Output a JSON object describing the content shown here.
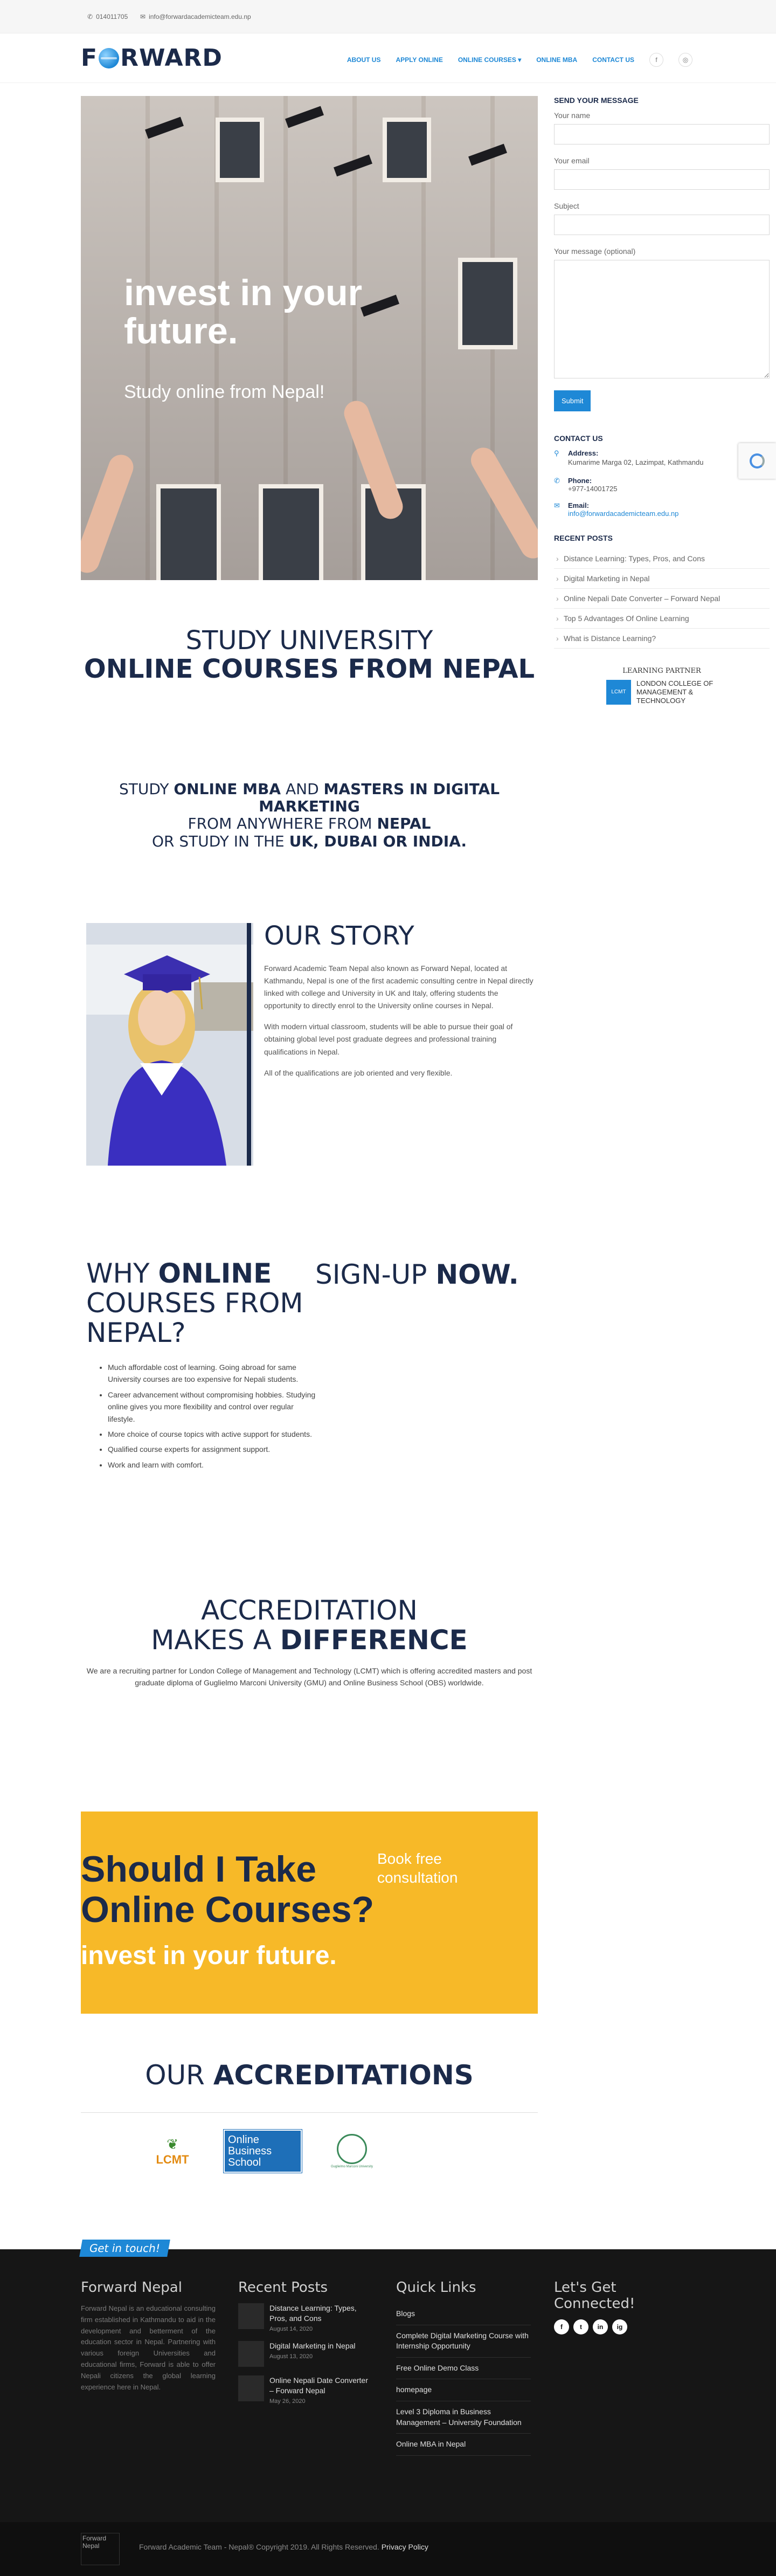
{
  "topbar": {
    "phone": "014011705",
    "email": "info@forwardacademicteam.edu.np"
  },
  "header": {
    "logo_left": "F",
    "logo_right": "RWARD",
    "nav": [
      "ABOUT US",
      "APPLY ONLINE",
      "ONLINE COURSES ▾",
      "ONLINE MBA",
      "CONTACT US"
    ],
    "social": [
      "facebook-icon",
      "instagram-icon"
    ]
  },
  "hero": {
    "title": "invest in your future.",
    "subtitle": "Study online from Nepal!"
  },
  "sidebar": {
    "form_title": "SEND YOUR MESSAGE",
    "name_label": "Your name",
    "email_label": "Your email",
    "subject_label": "Subject",
    "message_label": "Your message (optional)",
    "submit": "Submit",
    "contact_title": "CONTACT US",
    "address_label": "Address:",
    "address": "Kumarime Marga 02, Lazimpat, Kathmandu",
    "phone_label": "Phone:",
    "phone": "+977-14001725",
    "email_label2": "Email:",
    "email": "info@forwardacademicteam.edu.np",
    "posts_title": "RECENT POSTS",
    "posts": [
      "Distance Learning: Types, Pros, and Cons",
      "Digital Marketing in Nepal",
      "Online Nepali Date Converter – Forward Nepal",
      "Top 5 Advantages Of Online Learning",
      "What is Distance Learning?"
    ],
    "partner_label": "LEARNING PARTNER",
    "partner_name": "LONDON COLLEGE OF MANAGEMENT & TECHNOLOGY",
    "partner_mark": "LCMT"
  },
  "study": {
    "line1": "STUDY UNIVERSITY",
    "line2": "ONLINE COURSES FROM NEPAL"
  },
  "online": {
    "a1": "STUDY ",
    "a2": "ONLINE MBA",
    "a3": " AND ",
    "a4": "MASTERS IN DIGITAL MARKETING",
    "b1": "FROM ANYWHERE FROM ",
    "b2": "NEPAL",
    "c1": "OR STUDY IN THE ",
    "c2": "UK, DUBAI OR INDIA."
  },
  "story": {
    "title": "OUR STORY",
    "p1": "Forward Academic Team Nepal also known as Forward Nepal, located at Kathmandu, Nepal is one of the first academic consulting centre in Nepal directly linked with college and University in UK and Italy, offering students the opportunity to directly enrol to the University online courses in Nepal.",
    "p2": "With modern virtual classroom, students will be able to pursue their goal of obtaining global level post graduate degrees and professional training qualifications in Nepal.",
    "p3": "All of the qualifications are job oriented and very flexible."
  },
  "why": {
    "w1": "WHY ",
    "w2": "ONLINE",
    "w3": "COURSES FROM NEPAL?",
    "s1": "SIGN-UP ",
    "s2": "NOW.",
    "items": [
      "Much affordable cost of learning. Going abroad for same University courses are too expensive for Nepali students.",
      "Career advancement without compromising hobbies. Studying online gives you more flexibility and control over regular lifestyle.",
      "More choice of course topics with active support for students.",
      "Qualified course experts for assignment support.",
      "Work and learn with comfort."
    ]
  },
  "accreditation": {
    "l1": "ACCREDITATION",
    "l2a": "MAKES A ",
    "l2b": "DIFFERENCE",
    "desc": "We are a recruiting partner for London College of Management and Technology (LCMT) which is offering accredited masters and post graduate diploma of Guglielmo Marconi University (GMU) and Online Business School (OBS) worldwide."
  },
  "cta": {
    "question": "Should I Take Online Courses?",
    "book": "Book free consultation",
    "foot": "invest in your future."
  },
  "our_acc": {
    "a": "OUR ",
    "b": "ACCREDITATIONS",
    "logos": [
      "LCMT",
      "Online Business School",
      "Guglielmo Marconi University"
    ]
  },
  "footer": {
    "tab": "Get in touch!",
    "col1_title": "Forward Nepal",
    "col1_text": "Forward Nepal is an educational consulting firm established in Kathmandu to aid in the development and betterment of the education sector in Nepal. Partnering with various foreign Universities and educational firms, Forward is able to offer Nepali citizens the global learning experience here in Nepal.",
    "col2_title": "Recent Posts",
    "posts": [
      {
        "t": "Distance Learning: Types, Pros, and Cons",
        "d": "August 14, 2020"
      },
      {
        "t": "Digital Marketing in Nepal",
        "d": "August 13, 2020"
      },
      {
        "t": "Online Nepali Date Converter – Forward Nepal",
        "d": "May 26, 2020"
      }
    ],
    "col3_title": "Quick Links",
    "links": [
      "Blogs",
      "Complete Digital Marketing Course with Internship Opportunity",
      "Free Online Demo Class",
      "homepage",
      "Level 3 Diploma in Business Management – University Foundation",
      "Online MBA in Nepal"
    ],
    "col4_title": "Let's Get Connected!",
    "social": [
      "f",
      "t",
      "in",
      "ig"
    ]
  },
  "bottom": {
    "img_alt": "Forward Nepal",
    "copy": "Forward Academic Team - Nepal® Copyright 2019. All Rights Reserved. ",
    "privacy": "Privacy Policy"
  }
}
